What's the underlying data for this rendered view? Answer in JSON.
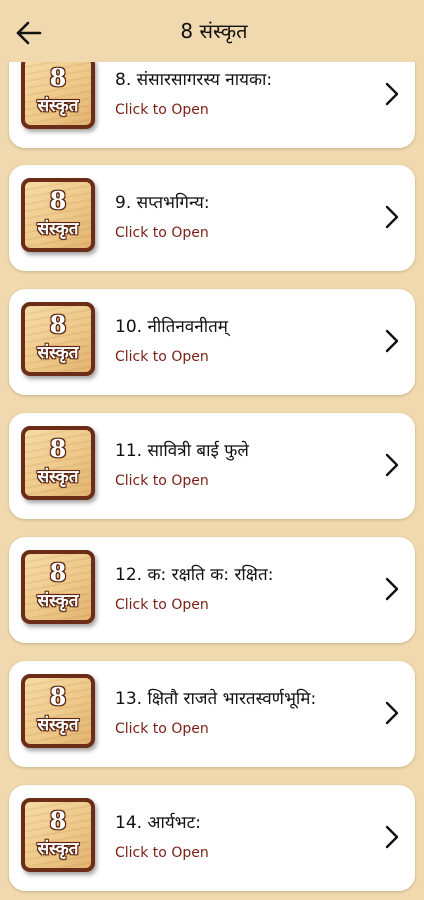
{
  "header": {
    "title": "8 संस्कृत"
  },
  "thumbnail": {
    "number": "8",
    "word": "संस्कृत"
  },
  "items": [
    {
      "title": "8. संसारसागरस्य नायका:",
      "subtitle": "Click to Open"
    },
    {
      "title": "9. सप्तभगिन्य:",
      "subtitle": "Click to Open"
    },
    {
      "title": "10. नीतिनवनीतम्",
      "subtitle": "Click to Open"
    },
    {
      "title": "11. सावित्री बाई फुले",
      "subtitle": "Click to Open"
    },
    {
      "title": "12. क: रक्षति क: रक्षित:",
      "subtitle": "Click to Open"
    },
    {
      "title": "13. क्षितौ राजते भारतस्वर्णभूमि:",
      "subtitle": "Click to Open"
    },
    {
      "title": "14. आर्यभट:",
      "subtitle": "Click to Open"
    }
  ]
}
